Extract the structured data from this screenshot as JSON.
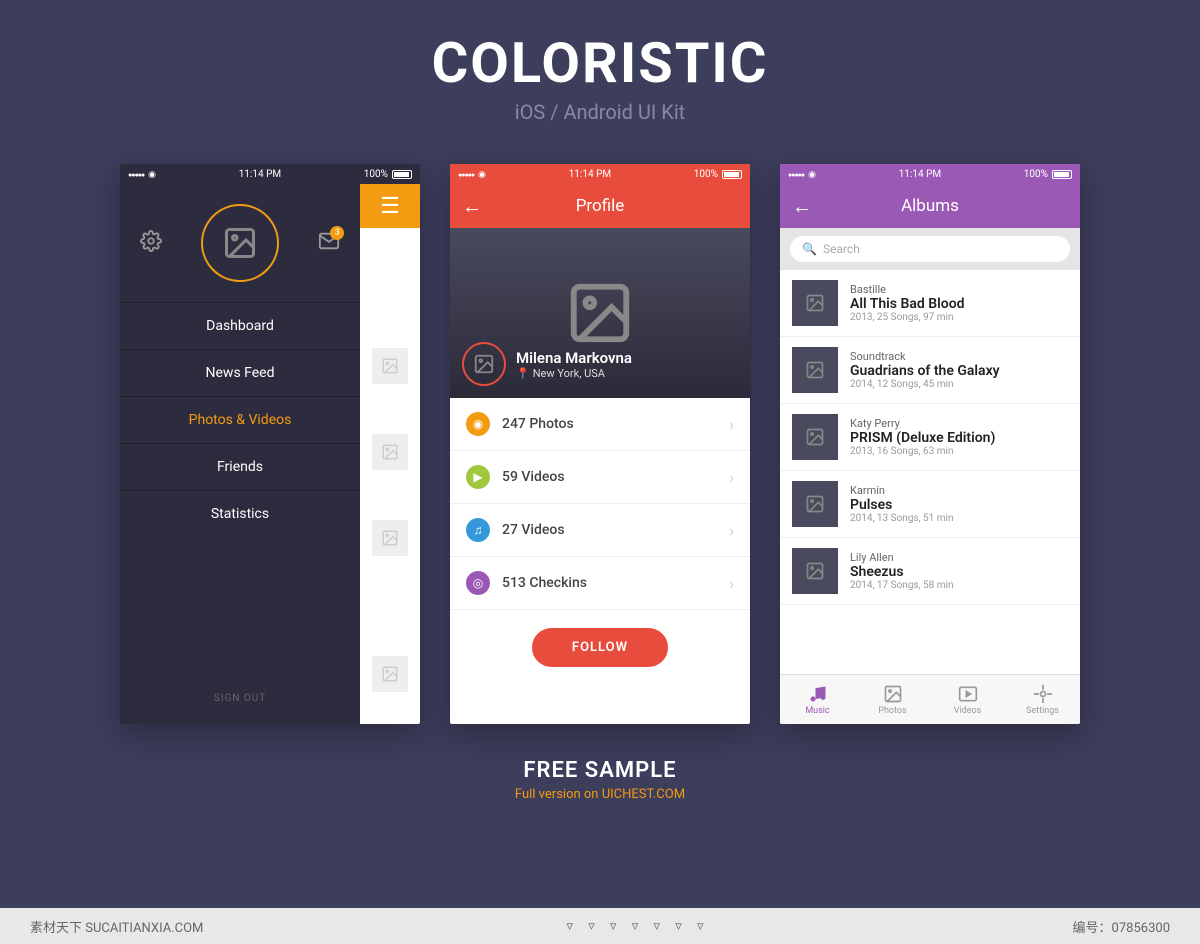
{
  "hero": {
    "title": "COLORISTIC",
    "subtitle": "iOS / Android UI Kit"
  },
  "status": {
    "time": "11:14 PM",
    "battery": "100%"
  },
  "phone1": {
    "badge": "3",
    "menu": [
      "Dashboard",
      "News Feed",
      "Photos & Videos",
      "Friends",
      "Statistics"
    ],
    "active": 2,
    "signout": "SIGN OUT"
  },
  "phone2": {
    "title": "Profile",
    "name": "Milena Markovna",
    "location": "New York, USA",
    "stats": [
      {
        "label": "247 Photos",
        "color": "#f39c12"
      },
      {
        "label": "59 Videos",
        "color": "#a0c83c"
      },
      {
        "label": "27 Videos",
        "color": "#3498db"
      },
      {
        "label": "513 Checkins",
        "color": "#9b59b6"
      }
    ],
    "follow": "FOLLOW"
  },
  "phone3": {
    "title": "Albums",
    "search_placeholder": "Search",
    "albums": [
      {
        "artist": "Bastille",
        "title": "All This Bad Blood",
        "detail": "2013, 25 Songs, 97 min"
      },
      {
        "artist": "Soundtrack",
        "title": "Guadrians of the Galaxy",
        "detail": "2014, 12 Songs, 45 min"
      },
      {
        "artist": "Katy Perry",
        "title": "PRISM (Deluxe Edition)",
        "detail": "2013, 16 Songs, 63 min"
      },
      {
        "artist": "Karmin",
        "title": "Pulses",
        "detail": "2014, 13 Songs, 51 min"
      },
      {
        "artist": "Lily Allen",
        "title": "Sheezus",
        "detail": "2014, 17 Songs, 58 min"
      }
    ],
    "tabs": [
      "Music",
      "Photos",
      "Videos",
      "Settings"
    ],
    "active_tab": 0
  },
  "footer": {
    "title": "FREE SAMPLE",
    "sub_prefix": "Full version on ",
    "sub_link": "UICHEST.COM"
  },
  "bottom": {
    "label": "素材天下 SUCAITIANXIA.COM",
    "id_label": "编号：",
    "id": "07856300"
  }
}
